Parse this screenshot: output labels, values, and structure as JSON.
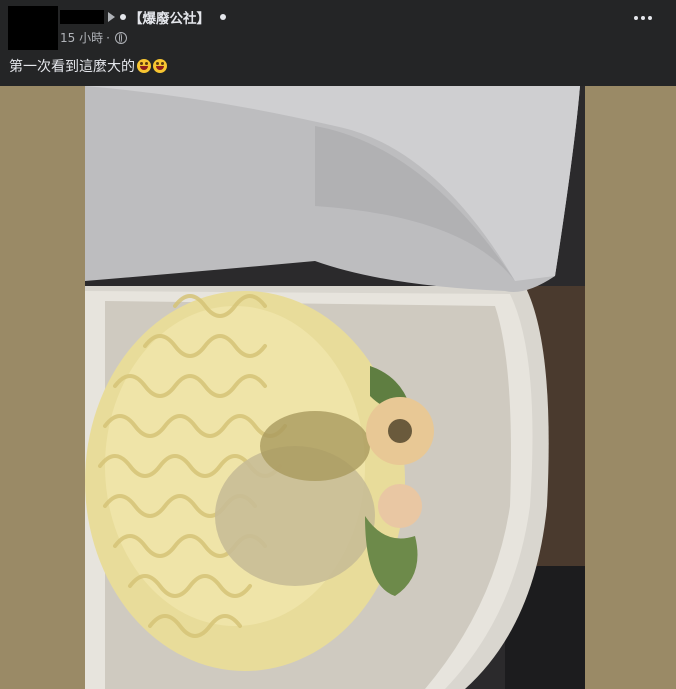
{
  "post": {
    "group_name": "【爆廢公社】",
    "time": "15 小時",
    "separator": "·",
    "privacy_icon": "globe-icon",
    "more_icon": "more-options-icon",
    "caption_text": "第一次看到這麼大的",
    "caption_emojis": [
      "grinning-face-icon",
      "grinning-face-icon"
    ],
    "photo_subject": "instant-noodle-cup-photo"
  },
  "colors": {
    "background": "#242526",
    "photo_backdrop": "#9a8a66",
    "text_primary": "#e4e6eb",
    "text_secondary": "#b0b3b8"
  }
}
